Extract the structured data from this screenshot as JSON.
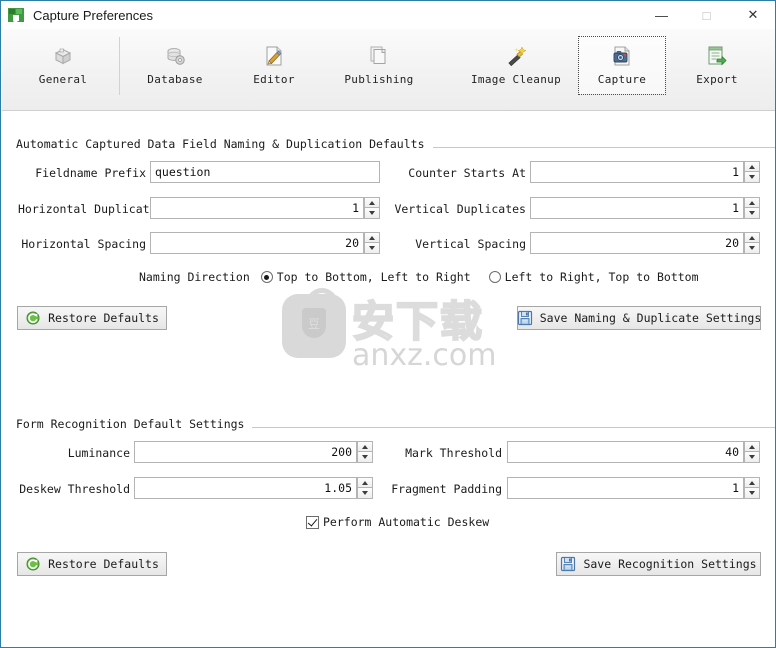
{
  "window": {
    "title": "Capture Preferences",
    "icon": "app-icon",
    "controls": {
      "minimize": "—",
      "maximize": "□",
      "close": "✕"
    }
  },
  "toolbar": {
    "items": [
      {
        "label": "General",
        "icon": "cube-icon",
        "selected": false
      },
      {
        "label": "Database",
        "icon": "database-gear-icon",
        "selected": false
      },
      {
        "label": "Editor",
        "icon": "page-pencil-icon",
        "selected": false
      },
      {
        "label": "Publishing",
        "icon": "pages-stack-icon",
        "selected": false
      },
      {
        "label": "Image Cleanup",
        "icon": "magic-wand-icon",
        "selected": false
      },
      {
        "label": "Capture",
        "icon": "camera-icon",
        "selected": true
      },
      {
        "label": "Export",
        "icon": "export-arrow-icon",
        "selected": false
      }
    ]
  },
  "sections": [
    {
      "title": "Automatic Captured Data Field Naming & Duplication Defaults",
      "fields": [
        {
          "label": "Fieldname Prefix",
          "value": "question",
          "type": "text",
          "placeholder": ""
        },
        {
          "label": "Counter Starts At",
          "value": "1",
          "type": "spinner"
        },
        {
          "label": "Horizontal Duplicates",
          "value": "1",
          "type": "spinner"
        },
        {
          "label": "Vertical Duplicates",
          "value": "1",
          "type": "spinner"
        },
        {
          "label": "Horizontal Spacing",
          "value": "20",
          "type": "spinner"
        },
        {
          "label": "Vertical Spacing",
          "value": "20",
          "type": "spinner"
        }
      ],
      "radio": {
        "label": "Naming Direction",
        "options": [
          {
            "label": "Top to Bottom, Left to Right",
            "selected": true
          },
          {
            "label": "Left to Right, Top to Bottom",
            "selected": false
          }
        ]
      },
      "buttons": {
        "restore": {
          "label": "Restore Defaults",
          "icon": "refresh-icon"
        },
        "save": {
          "label": "Save Naming & Duplicate Settings",
          "icon": "floppy-save-icon"
        }
      }
    },
    {
      "title": "Form Recognition Default Settings",
      "fields": [
        {
          "label": "Luminance",
          "value": "200",
          "type": "spinner"
        },
        {
          "label": "Mark Threshold",
          "value": "40",
          "type": "spinner"
        },
        {
          "label": "Deskew Threshold",
          "value": "1.05",
          "type": "spinner"
        },
        {
          "label": "Fragment Padding",
          "value": "1",
          "type": "spinner"
        }
      ],
      "checkbox": {
        "label": "Perform Automatic Deskew",
        "checked": true
      },
      "buttons": {
        "restore": {
          "label": "Restore Defaults",
          "icon": "refresh-icon"
        },
        "save": {
          "label": "Save Recognition Settings",
          "icon": "floppy-save-icon"
        }
      }
    }
  ],
  "watermark": {
    "cn_text": "安下载",
    "url_text": "anxz.com",
    "logo_glyph": "豆"
  },
  "colors": {
    "window_border": "#2a7ea8",
    "toolbar_bg": "#f2f2f2",
    "text": "#1b1b1b",
    "field_border": "#b4b4b4",
    "accent_green": "#4aa02c",
    "accent_blue": "#4a86c8"
  }
}
